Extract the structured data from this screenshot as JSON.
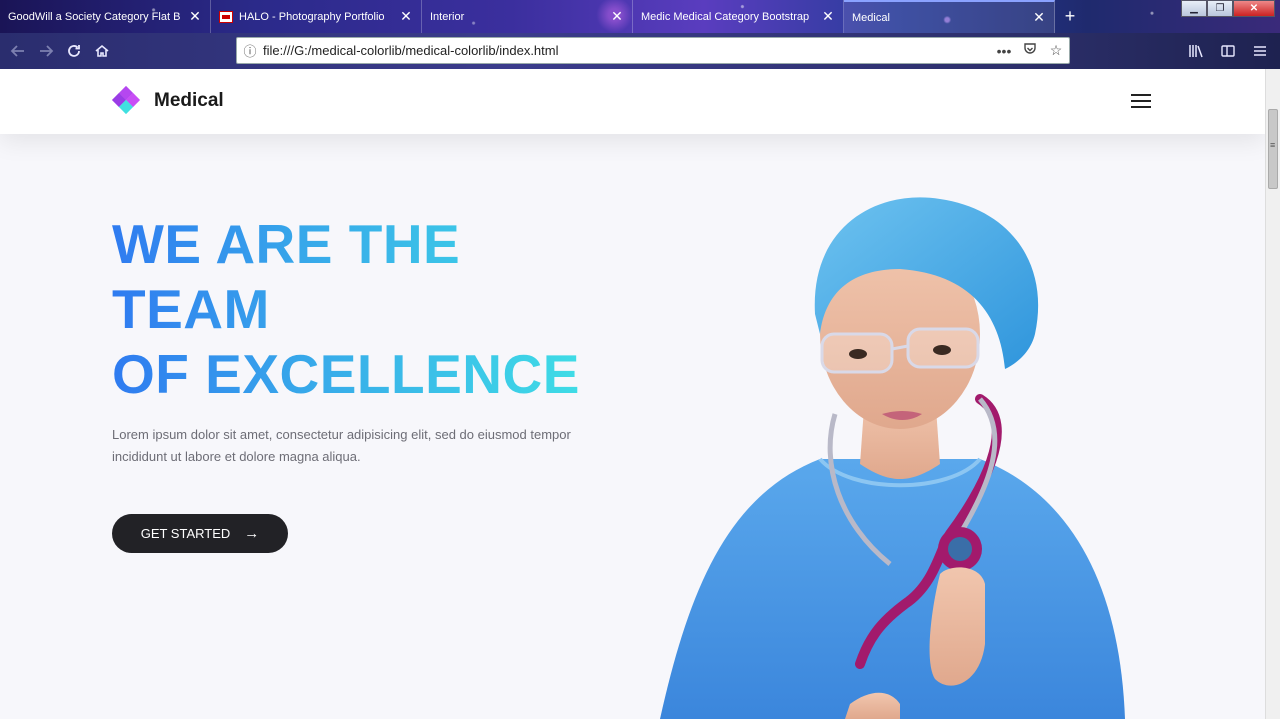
{
  "browser": {
    "tabs": [
      {
        "title": "GoodWill a Society Category Flat B",
        "active": false
      },
      {
        "title": "HALO - Photography Portfolio",
        "active": false
      },
      {
        "title": "Interior",
        "active": false
      },
      {
        "title": "Medic Medical Category Bootstrap",
        "active": false
      },
      {
        "title": "Medical",
        "active": true
      }
    ],
    "close_glyph": "✕",
    "new_tab_glyph": "+",
    "url": "file:///G:/medical-colorlib/medical-colorlib/index.html",
    "window_controls": {
      "minimize": "▁",
      "maximize": "❐",
      "close": "✕"
    },
    "icons": {
      "back": "back-arrow-icon",
      "forward": "forward-arrow-icon",
      "reload": "reload-icon",
      "home": "home-icon",
      "info": "info-icon",
      "more": "more-dots-icon",
      "pocket": "pocket-icon",
      "bookmark": "star-icon",
      "library": "library-icon",
      "sidebar": "sidebar-icon",
      "menu": "menu-icon"
    }
  },
  "site": {
    "brand": "Medical",
    "hero": {
      "title_lines": [
        "WE ARE THE",
        "TEAM",
        "OF EXCELLENCE"
      ],
      "text": "Lorem ipsum dolor sit amet, consectetur adipisicing elit, sed do eiusmod tempor incididunt ut labore et dolore magna aliqua.",
      "cta_label": "GET STARTED",
      "cta_arrow": "→"
    },
    "colors": {
      "gradient_start": "#2f7bf0",
      "gradient_end": "#3fdce6",
      "button_bg": "#222226",
      "logo_purple": "#b547f0",
      "logo_cyan": "#3fe0e0"
    }
  }
}
